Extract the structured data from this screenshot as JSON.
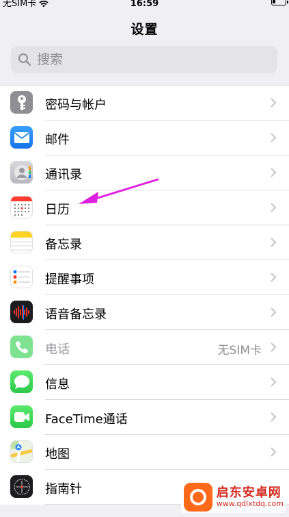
{
  "status_bar": {
    "carrier": "无SIM卡",
    "time": "16:59"
  },
  "nav": {
    "title": "设置"
  },
  "search": {
    "placeholder": "搜索"
  },
  "rows": [
    {
      "label": "密码与帐户",
      "icon": "key-icon",
      "color": "#8e8e93"
    },
    {
      "label": "邮件",
      "icon": "mail-icon",
      "color": "#1e88f5"
    },
    {
      "label": "通讯录",
      "icon": "contacts-icon",
      "color": "#c8c8cc"
    },
    {
      "label": "日历",
      "icon": "calendar-icon",
      "color": "#ffffff"
    },
    {
      "label": "备忘录",
      "icon": "notes-icon",
      "color": "#ffd426"
    },
    {
      "label": "提醒事项",
      "icon": "reminders-icon",
      "color": "#ffffff"
    },
    {
      "label": "语音备忘录",
      "icon": "voice-memo-icon",
      "color": "#1c1c1e"
    },
    {
      "label": "电话",
      "value": "无SIM卡",
      "icon": "phone-icon",
      "color": "#4cd964"
    },
    {
      "label": "信息",
      "icon": "messages-icon",
      "color": "#34c759"
    },
    {
      "label": "FaceTime通话",
      "icon": "facetime-icon",
      "color": "#34c759"
    },
    {
      "label": "地图",
      "icon": "maps-icon",
      "color": "#e8f0e0"
    },
    {
      "label": "指南针",
      "icon": "compass-icon",
      "color": "#1c1c1e"
    }
  ],
  "annotation": {
    "arrow_color": "#e020e0"
  },
  "watermark": {
    "title": "启东安卓网",
    "url": "www.qdlxtdq.com"
  }
}
